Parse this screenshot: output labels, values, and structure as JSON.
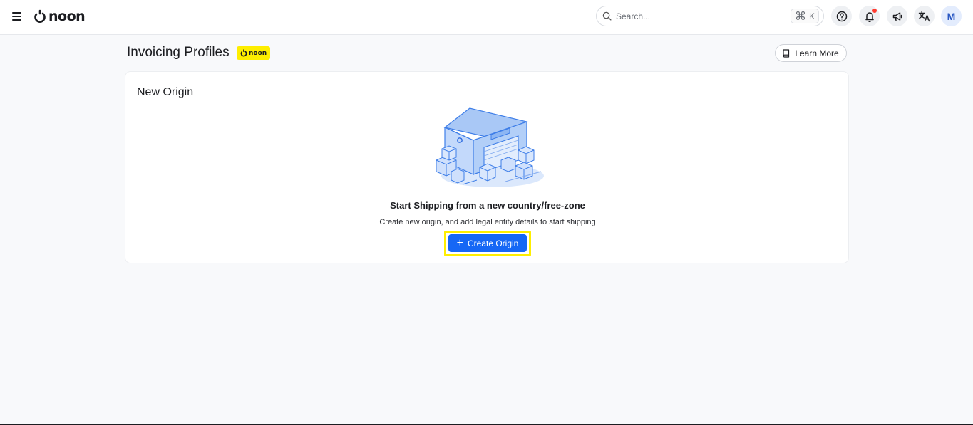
{
  "header": {
    "logo_text": "noon",
    "search": {
      "placeholder": "Search...",
      "shortcut_key": "K",
      "shortcut_symbol": "⌘"
    },
    "avatar_initial": "M"
  },
  "page": {
    "title": "Invoicing Profiles",
    "badge_text": "noon",
    "learn_more_label": "Learn More"
  },
  "card": {
    "title": "New Origin",
    "empty_state": {
      "heading": "Start Shipping from a new country/free-zone",
      "subtext": "Create new origin, and add legal entity details to start shipping",
      "button_label": "Create Origin",
      "button_icon": "+"
    }
  },
  "colors": {
    "brand_yellow": "#feee00",
    "primary_blue": "#1667f5",
    "notification_dot": "#ff3b30"
  }
}
